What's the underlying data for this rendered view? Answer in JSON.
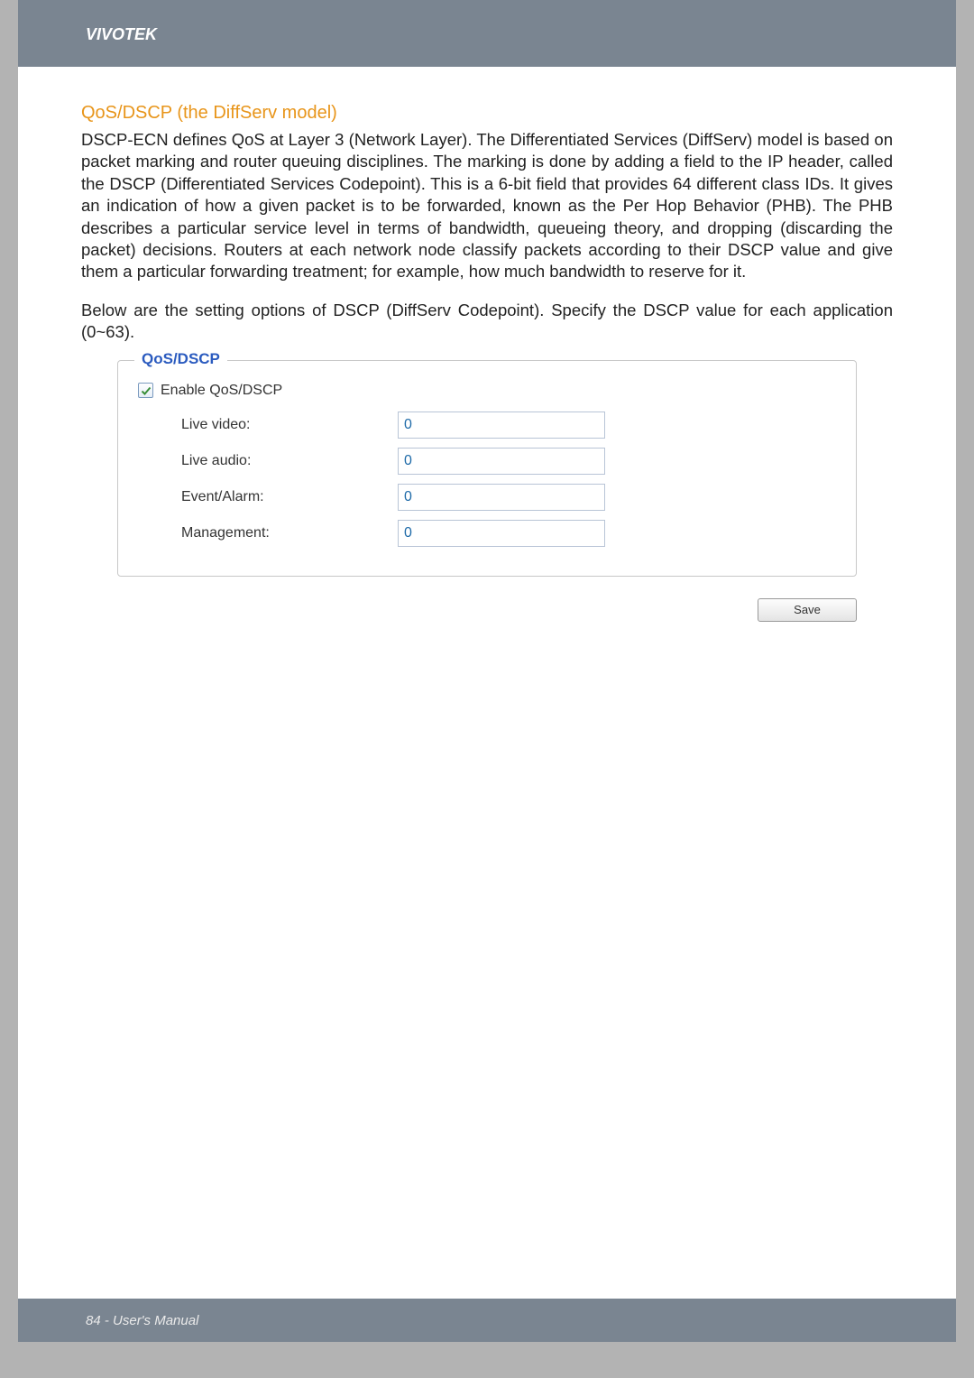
{
  "header": {
    "brand": "VIVOTEK"
  },
  "section": {
    "heading": "QoS/DSCP (the DiffServ model)",
    "paragraph1": "DSCP-ECN defines QoS at Layer 3 (Network Layer). The Differentiated Services (DiffServ) model is based on packet marking and router queuing disciplines. The marking is done by adding a field to the IP header, called the DSCP (Differentiated Services Codepoint). This is a 6-bit field that provides 64 different class IDs. It gives an indication of how a given packet is to be forwarded, known as the Per Hop Behavior (PHB). The PHB describes a particular service level in terms of bandwidth, queueing theory, and dropping (discarding the packet) decisions. Routers at each network node classify packets according to their DSCP value and give them a particular forwarding treatment; for example, how much bandwidth to reserve for it.",
    "paragraph2": "Below are the setting options of DSCP (DiffServ Codepoint). Specify the DSCP value for each application (0~63).",
    "fieldset_legend": "QoS/DSCP",
    "checkbox_label": "Enable QoS/DSCP",
    "fields": {
      "live_video": {
        "label": "Live video:",
        "value": "0"
      },
      "live_audio": {
        "label": "Live audio:",
        "value": "0"
      },
      "event_alarm": {
        "label": "Event/Alarm:",
        "value": "0"
      },
      "management": {
        "label": "Management:",
        "value": "0"
      }
    },
    "save_label": "Save"
  },
  "footer": {
    "text": "84 - User's Manual"
  }
}
